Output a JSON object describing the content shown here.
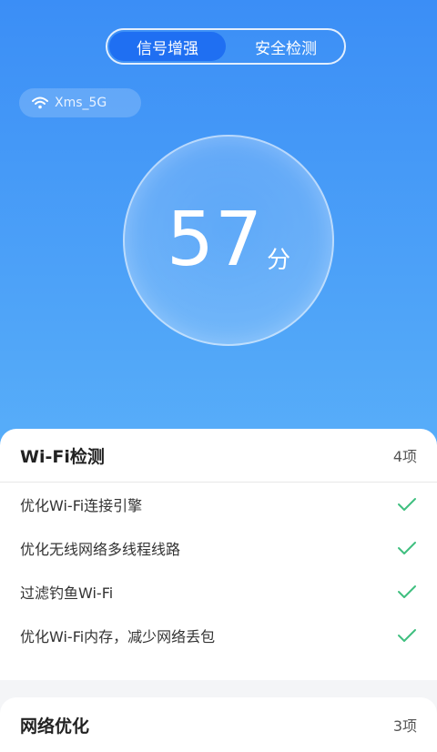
{
  "tabs": [
    {
      "label": "信号增强",
      "active": true
    },
    {
      "label": "安全检测",
      "active": false
    }
  ],
  "network": {
    "ssid": "Xms_5G",
    "icon": "wifi-icon"
  },
  "score": {
    "value": "57",
    "unit": "分"
  },
  "wifi_check": {
    "title": "Wi-Fi检测",
    "count": "4项",
    "items": [
      {
        "label": "优化Wi-Fi连接引擎",
        "status": "check-icon"
      },
      {
        "label": "优化无线网络多线程线路",
        "status": "check-icon"
      },
      {
        "label": "过滤钓鱼Wi-Fi",
        "status": "check-icon"
      },
      {
        "label": "优化Wi-Fi内存，减少网络丢包",
        "status": "check-icon"
      }
    ]
  },
  "net_opt": {
    "title": "网络优化",
    "count": "3项"
  },
  "colors": {
    "accent": "#1f6ff2",
    "check": "#3fbf7f",
    "hero_top": "#3b8ef6",
    "hero_bottom": "#58aef9"
  }
}
